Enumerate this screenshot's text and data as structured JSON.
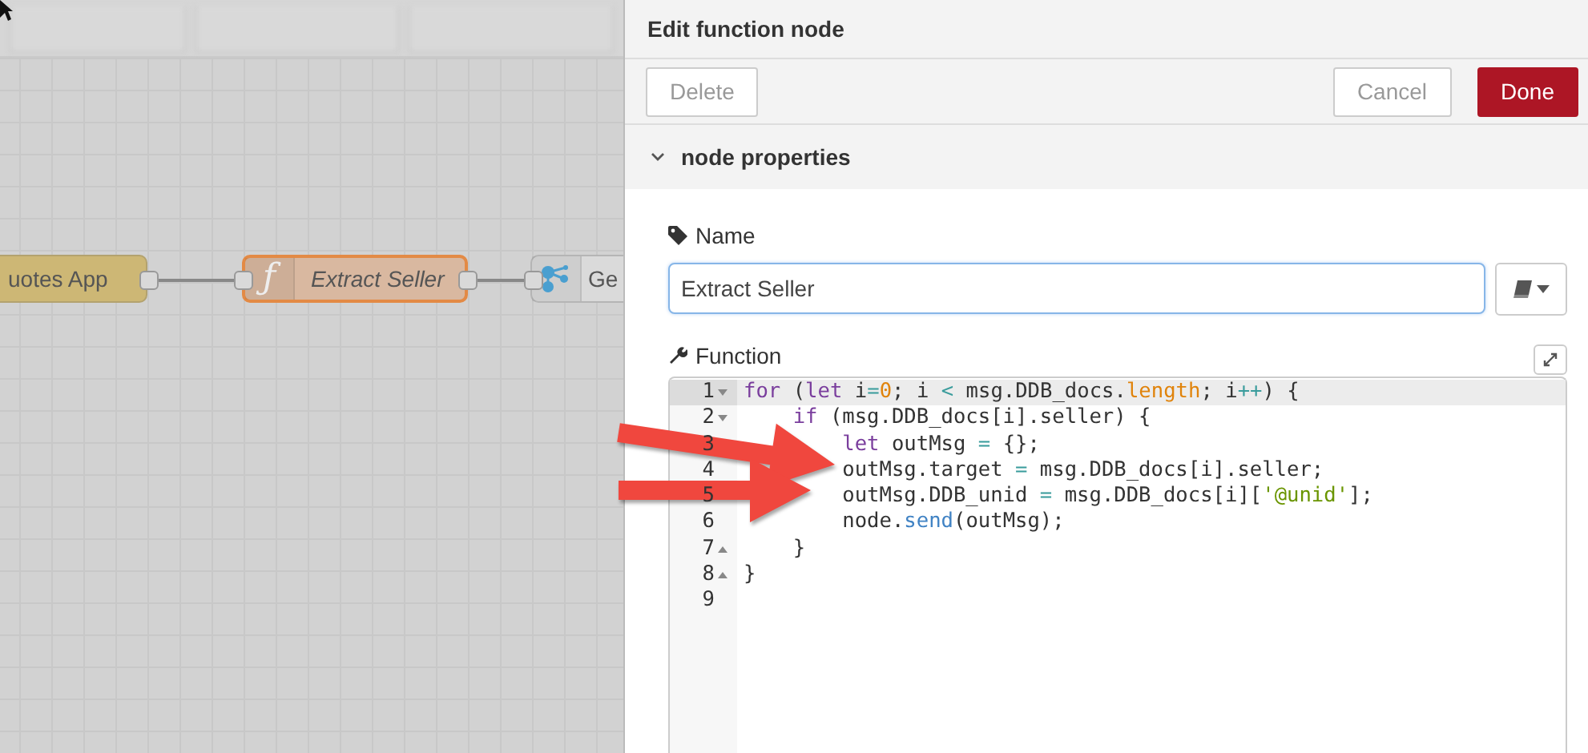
{
  "canvas": {
    "nodes": [
      {
        "label": "uotes App",
        "kind": "inject",
        "selected": false
      },
      {
        "label": "Extract Seller",
        "kind": "function",
        "icon_text": "ƒ",
        "selected": true
      },
      {
        "label": "Ge",
        "kind": "change",
        "selected": false
      }
    ]
  },
  "panel": {
    "title": "Edit function node",
    "buttons": [
      {
        "label": "Delete",
        "kind": "secondary"
      },
      {
        "label": "Cancel",
        "kind": "secondary"
      },
      {
        "label": "Done",
        "kind": "primary"
      }
    ],
    "section": {
      "title": "node properties",
      "expanded": true
    },
    "name_field": {
      "label": "Name",
      "value": "Extract Seller"
    },
    "function_label": "Function",
    "code": [
      {
        "number": "1",
        "fold": {
          "kind": "start"
        },
        "active": true,
        "tokens": [
          {
            "kind": "kw",
            "t": "for"
          },
          {
            "kind": "plain",
            "t": " ("
          },
          {
            "kind": "kw",
            "t": "let"
          },
          {
            "kind": "plain",
            "t": " i"
          },
          {
            "kind": "op",
            "t": "="
          },
          {
            "kind": "num",
            "t": "0"
          },
          {
            "kind": "plain",
            "t": "; i "
          },
          {
            "kind": "op",
            "t": "<"
          },
          {
            "kind": "plain",
            "t": " msg.DDB_docs."
          },
          {
            "kind": "prop",
            "t": "length"
          },
          {
            "kind": "plain",
            "t": "; i"
          },
          {
            "kind": "op",
            "t": "++"
          },
          {
            "kind": "plain",
            "t": ") {"
          }
        ]
      },
      {
        "number": "2",
        "fold": {
          "kind": "start"
        },
        "active": false,
        "tokens": [
          {
            "kind": "kw",
            "t": "    if"
          },
          {
            "kind": "plain",
            "t": " (msg.DDB_docs[i].seller) {"
          }
        ]
      },
      {
        "number": "3",
        "active": false,
        "tokens": [
          {
            "kind": "kw",
            "t": "        let"
          },
          {
            "kind": "plain",
            "t": " outMsg "
          },
          {
            "kind": "op",
            "t": "="
          },
          {
            "kind": "plain",
            "t": " {};"
          }
        ]
      },
      {
        "number": "4",
        "active": false,
        "tokens": [
          {
            "kind": "plain",
            "t": "        outMsg.target "
          },
          {
            "kind": "op",
            "t": "="
          },
          {
            "kind": "plain",
            "t": " msg.DDB_docs[i].seller;"
          }
        ]
      },
      {
        "number": "5",
        "active": false,
        "tokens": [
          {
            "kind": "plain",
            "t": "        outMsg.DDB_unid "
          },
          {
            "kind": "op",
            "t": "="
          },
          {
            "kind": "plain",
            "t": " msg.DDB_docs[i]["
          },
          {
            "kind": "str",
            "t": "'@unid'"
          },
          {
            "kind": "plain",
            "t": "];"
          }
        ]
      },
      {
        "number": "6",
        "active": false,
        "tokens": [
          {
            "kind": "plain",
            "t": "        node."
          },
          {
            "kind": "fn",
            "t": "send"
          },
          {
            "kind": "plain",
            "t": "(outMsg);"
          }
        ]
      },
      {
        "number": "7",
        "fold": {
          "kind": "end"
        },
        "active": false,
        "tokens": [
          {
            "kind": "plain",
            "t": "    }"
          }
        ]
      },
      {
        "number": "8",
        "fold": {
          "kind": "end"
        },
        "active": false,
        "tokens": [
          {
            "kind": "plain",
            "t": "}"
          }
        ]
      },
      {
        "number": "9",
        "active": false
      }
    ]
  }
}
